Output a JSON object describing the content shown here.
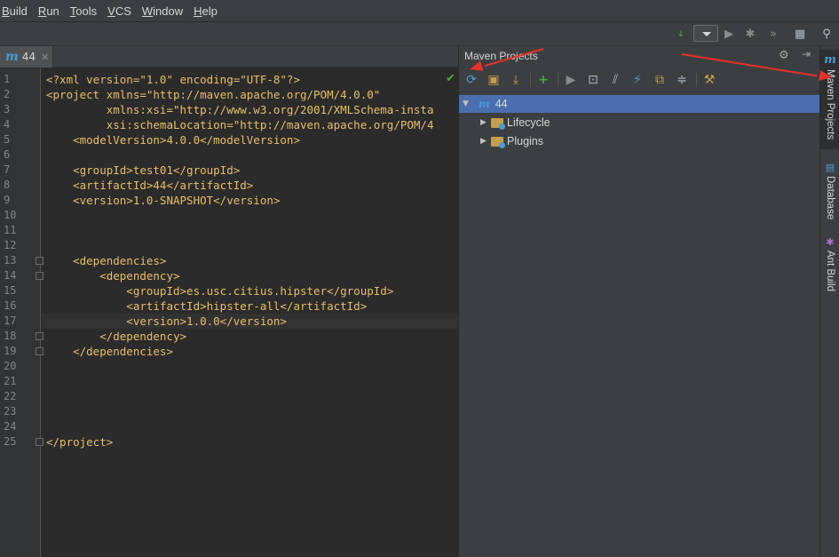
{
  "menu": [
    "Build",
    "Run",
    "Tools",
    "VCS",
    "Window",
    "Help"
  ],
  "tab": {
    "icon": "m",
    "label": "44"
  },
  "editor": {
    "line_numbers": [
      "1",
      "2",
      "3",
      "4",
      "5",
      "6",
      "7",
      "8",
      "9",
      "10",
      "11",
      "12",
      "13",
      "14",
      "15",
      "16",
      "17",
      "18",
      "19",
      "20",
      "21",
      "22",
      "23",
      "24",
      "25"
    ],
    "lines": [
      "<?xml version=\"1.0\" encoding=\"UTF-8\"?>",
      "<project xmlns=\"http://maven.apache.org/POM/4.0.0\"",
      "         xmlns:xsi=\"http://www.w3.org/2001/XMLSchema-insta",
      "         xsi:schemaLocation=\"http://maven.apache.org/POM/4",
      "    <modelVersion>4.0.0</modelVersion>",
      "",
      "    <groupId>test01</groupId>",
      "    <artifactId>44</artifactId>",
      "    <version>1.0-SNAPSHOT</version>",
      "",
      "",
      "",
      "    <dependencies>",
      "        <dependency>",
      "            <groupId>es.usc.citius.hipster</groupId>",
      "            <artifactId>hipster-all</artifactId>",
      "            <version>1.0.0</version>",
      "        </dependency>",
      "    </dependencies>",
      "",
      "",
      "",
      "",
      "",
      "</project>"
    ]
  },
  "maven": {
    "title": "Maven Projects",
    "root": "44",
    "children": [
      "Lifecycle",
      "Plugins"
    ]
  },
  "side_tabs": [
    "Maven Projects",
    "Database",
    "Ant Build"
  ],
  "colors": {
    "arrow": "#e8302a",
    "selection": "#4b6eaf",
    "accent": "#4a9bd6"
  }
}
